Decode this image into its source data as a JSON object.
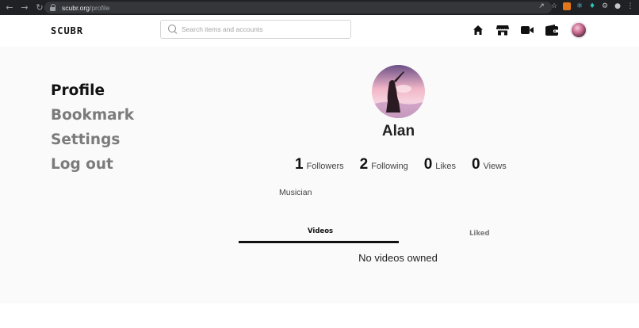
{
  "browser": {
    "url_host": "scubr.org",
    "url_path": "/profile"
  },
  "header": {
    "logo": "SCUBR",
    "search_placeholder": "Search items and accounts",
    "icons": [
      "home-icon",
      "store-icon",
      "video-camera-icon",
      "wallet-icon",
      "avatar"
    ]
  },
  "sidebar": {
    "items": [
      {
        "label": "Profile",
        "active": true
      },
      {
        "label": "Bookmark",
        "active": false
      },
      {
        "label": "Settings",
        "active": false
      },
      {
        "label": "Log out",
        "active": false
      }
    ]
  },
  "profile": {
    "name": "Alan",
    "bio": "Musician",
    "stats": [
      {
        "value": "1",
        "label": "Followers"
      },
      {
        "value": "2",
        "label": "Following"
      },
      {
        "value": "0",
        "label": "Likes"
      },
      {
        "value": "0",
        "label": "Views"
      }
    ]
  },
  "tabs": {
    "videos": "Videos",
    "liked": "Liked",
    "active": "Videos"
  },
  "content": {
    "empty_message": "No videos owned"
  }
}
